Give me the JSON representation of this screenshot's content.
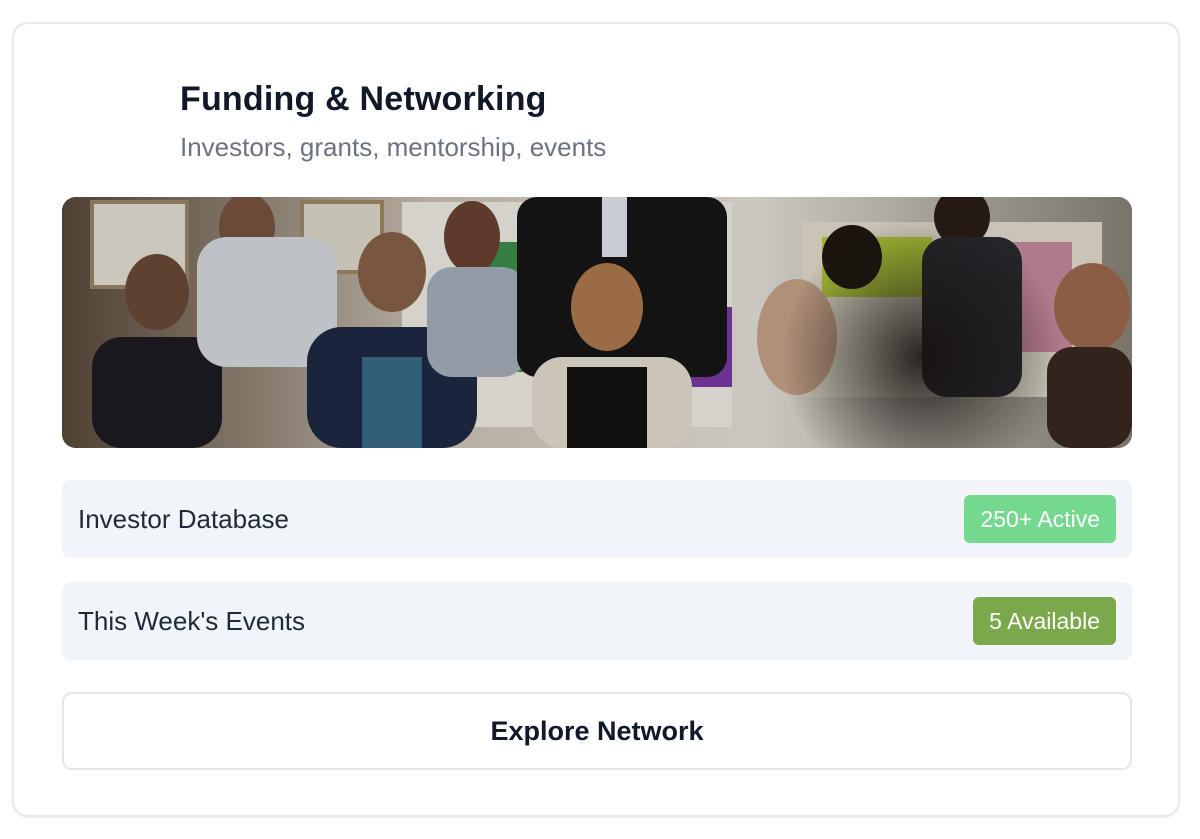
{
  "card": {
    "title": "Funding & Networking",
    "subtitle": "Investors, grants, mentorship, events"
  },
  "hero_image": {
    "description_icon": "networking-event-photo"
  },
  "stats": [
    {
      "label": "Investor Database",
      "badge": "250+ Active",
      "badge_color": "#74d98f"
    },
    {
      "label": "This Week's Events",
      "badge": "5 Available",
      "badge_color": "#7ba84a"
    }
  ],
  "actions": {
    "explore_label": "Explore Network"
  }
}
